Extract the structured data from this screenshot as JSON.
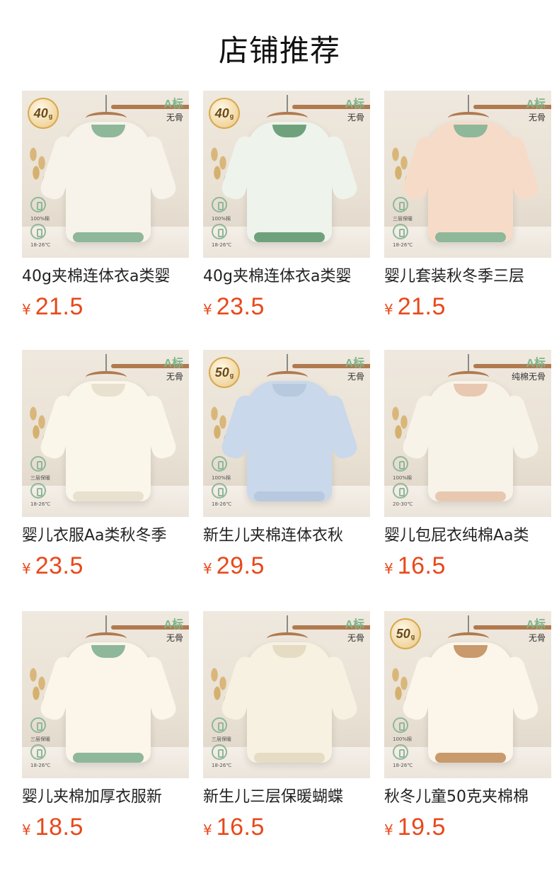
{
  "section_title": "店铺推荐",
  "currency_symbol": "¥",
  "products": [
    {
      "name": "40g夹棉连体衣a类婴",
      "price": "21.5",
      "badge": "40",
      "tag_top": "A标",
      "tag_sub": "无骨",
      "icon_caption_1": "100%棉",
      "icon_caption_2": "18-26℃",
      "palette": {
        "body": "#f7f3ea",
        "trim": "#8fb79a"
      }
    },
    {
      "name": "40g夹棉连体衣a类婴",
      "price": "23.5",
      "badge": "40",
      "tag_top": "A标",
      "tag_sub": "无骨",
      "icon_caption_1": "100%棉",
      "icon_caption_2": "18-26℃",
      "palette": {
        "body": "#eef3ec",
        "trim": "#6fa27c"
      }
    },
    {
      "name": "婴儿套装秋冬季三层",
      "price": "21.5",
      "badge": "",
      "tag_top": "A标",
      "tag_sub": "无骨",
      "icon_caption_1": "三层保暖",
      "icon_caption_2": "18-26℃",
      "palette": {
        "body": "#f6dcc8",
        "trim": "#8fb79a"
      }
    },
    {
      "name": "婴儿衣服Aa类秋冬季",
      "price": "23.5",
      "badge": "",
      "tag_top": "A标",
      "tag_sub": "无骨",
      "icon_caption_1": "三层保暖",
      "icon_caption_2": "18-26℃",
      "palette": {
        "body": "#fbf6ea",
        "trim": "#e9e1cf"
      }
    },
    {
      "name": "新生儿夹棉连体衣秋",
      "price": "29.5",
      "badge": "50",
      "tag_top": "A标",
      "tag_sub": "无骨",
      "icon_caption_1": "100%棉",
      "icon_caption_2": "18-26℃",
      "palette": {
        "body": "#c9d8ea",
        "trim": "#b7c9de"
      }
    },
    {
      "name": "婴儿包屁衣纯棉Aa类",
      "price": "16.5",
      "badge": "",
      "tag_top": "A标",
      "tag_sub": "纯棉无骨",
      "icon_caption_1": "100%棉",
      "icon_caption_2": "20-30℃",
      "palette": {
        "body": "#f8f3e8",
        "trim": "#e8c8b0"
      }
    },
    {
      "name": "婴儿夹棉加厚衣服新",
      "price": "18.5",
      "badge": "",
      "tag_top": "A标",
      "tag_sub": "无骨",
      "icon_caption_1": "三层保暖",
      "icon_caption_2": "18-26℃",
      "palette": {
        "body": "#fbf6e9",
        "trim": "#8fb79a"
      }
    },
    {
      "name": "新生儿三层保暖蝴蝶",
      "price": "16.5",
      "badge": "",
      "tag_top": "A标",
      "tag_sub": "无骨",
      "icon_caption_1": "三层保暖",
      "icon_caption_2": "18-26℃",
      "palette": {
        "body": "#f7f1e2",
        "trim": "#e6dcc4"
      }
    },
    {
      "name": "秋冬儿童50克夹棉棉",
      "price": "19.5",
      "badge": "50",
      "tag_top": "A标",
      "tag_sub": "无骨",
      "icon_caption_1": "100%棉",
      "icon_caption_2": "18-26℃",
      "palette": {
        "body": "#fbf5ea",
        "trim": "#c89a6c"
      }
    }
  ]
}
